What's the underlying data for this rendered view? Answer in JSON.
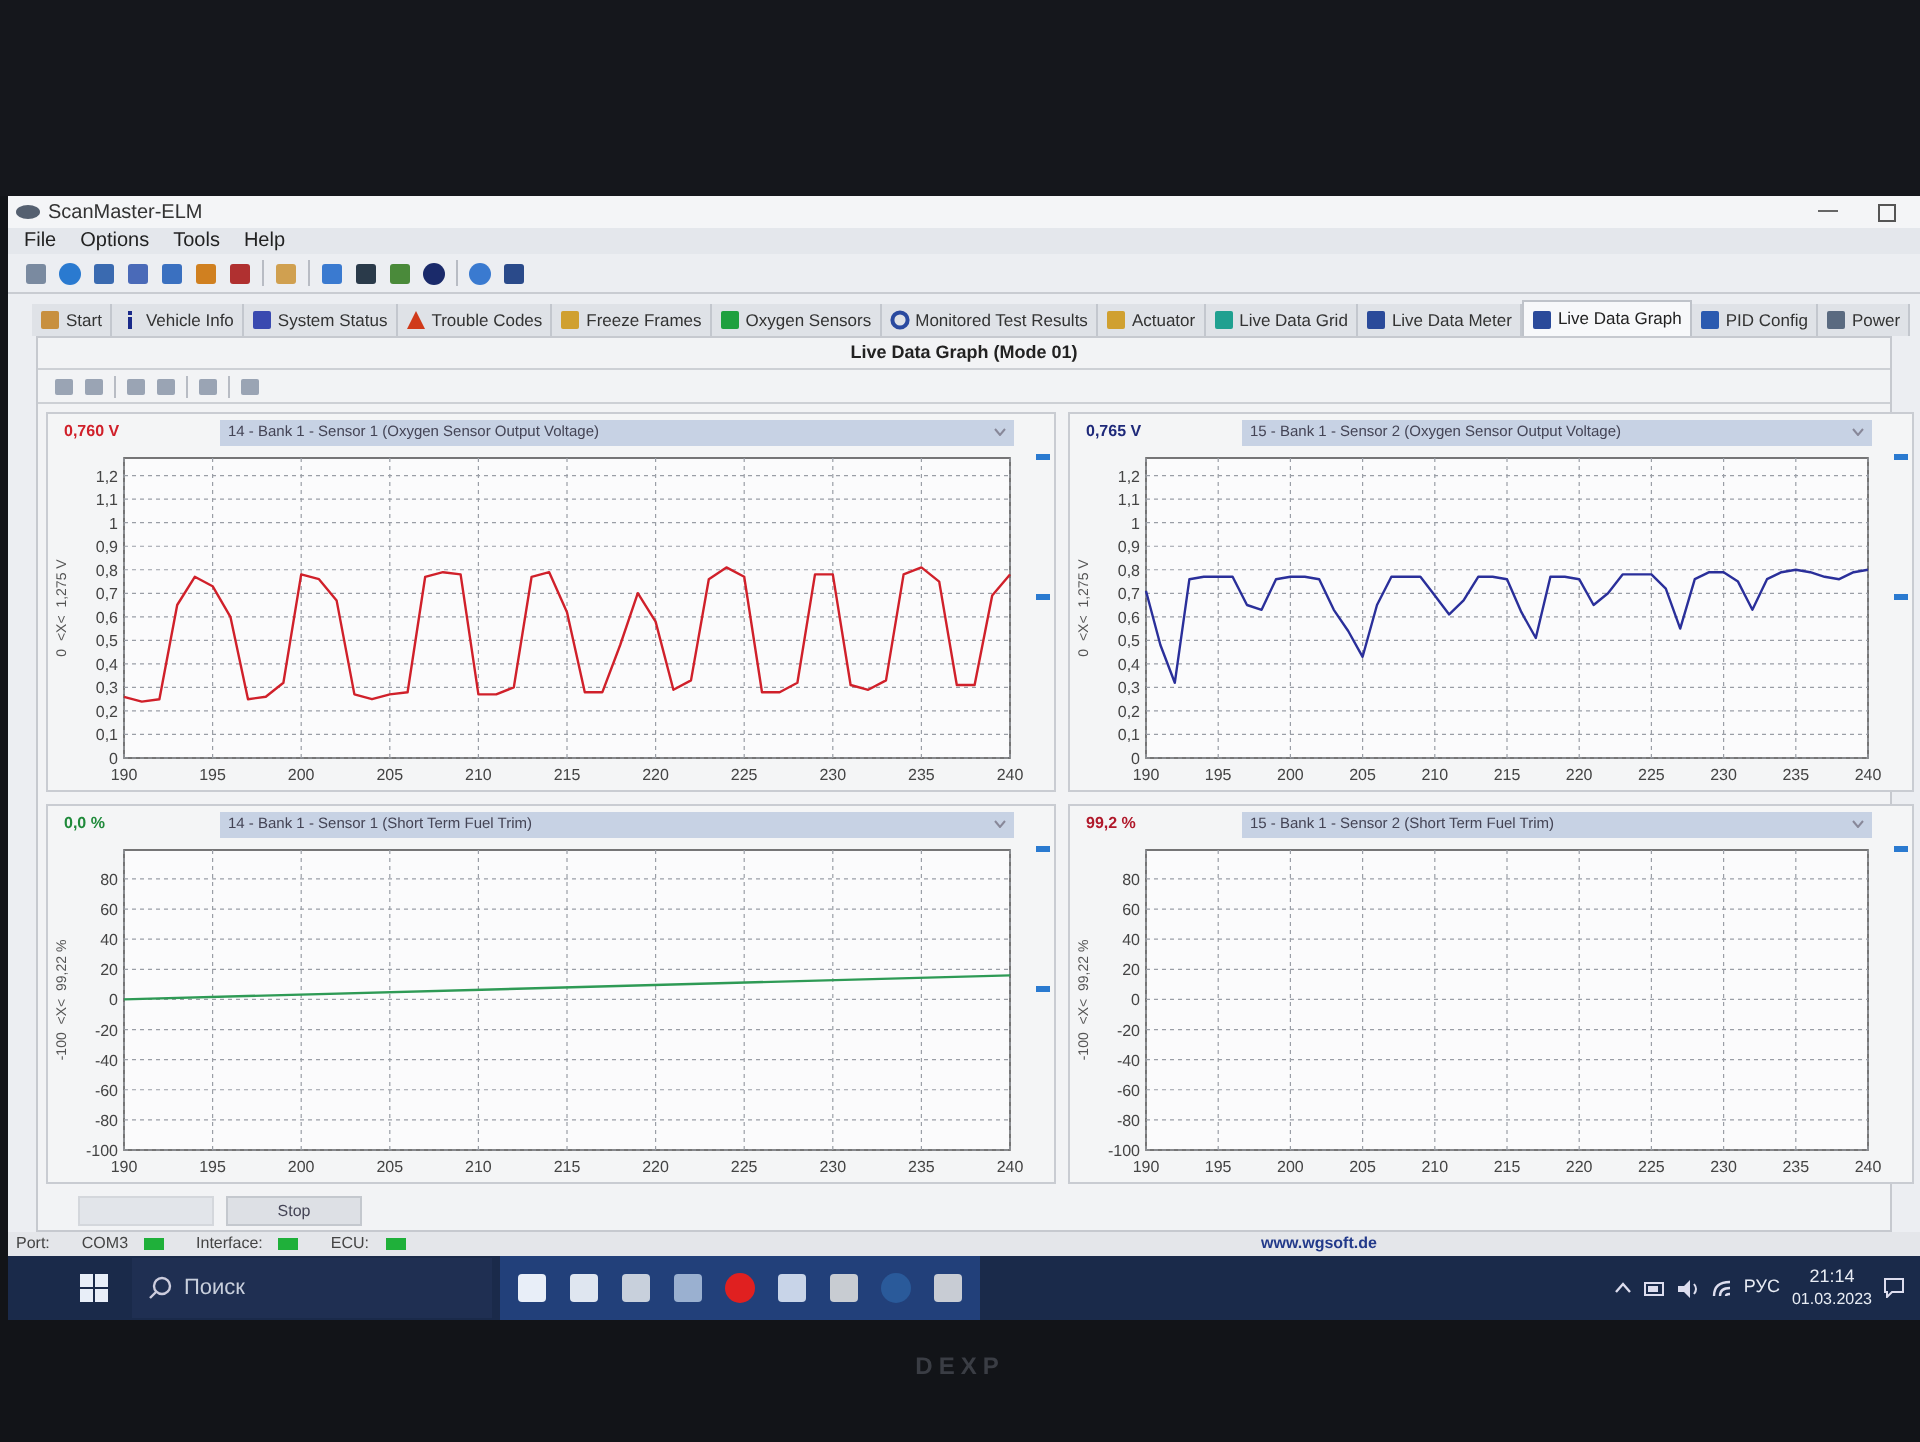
{
  "window": {
    "title": "ScanMaster-ELM"
  },
  "menu": [
    "File",
    "Options",
    "Tools",
    "Help"
  ],
  "tabs": [
    {
      "label": "Start",
      "selected": false
    },
    {
      "label": "Vehicle Info",
      "selected": false
    },
    {
      "label": "System Status",
      "selected": false
    },
    {
      "label": "Trouble Codes",
      "selected": false
    },
    {
      "label": "Freeze Frames",
      "selected": false
    },
    {
      "label": "Oxygen Sensors",
      "selected": false
    },
    {
      "label": "Monitored Test Results",
      "selected": false
    },
    {
      "label": "Actuator",
      "selected": false
    },
    {
      "label": "Live Data Grid",
      "selected": false
    },
    {
      "label": "Live Data Meter",
      "selected": false
    },
    {
      "label": "Live Data Graph",
      "selected": true
    },
    {
      "label": "PID Config",
      "selected": false
    },
    {
      "label": "Power",
      "selected": false
    }
  ],
  "page_title": "Live Data Graph (Mode 01)",
  "graphs": [
    {
      "reading": "0,760 V",
      "color": "#d0202a",
      "parameter": "14 - Bank 1 - Sensor 1 (Oxygen Sensor Output Voltage)",
      "chart_data": {
        "type": "line",
        "ylabel": "0  <X<  1,275 V",
        "xlim": [
          190,
          240
        ],
        "ylim": [
          0,
          1.275
        ],
        "xticks": [
          190,
          195,
          200,
          205,
          210,
          215,
          220,
          225,
          230,
          235,
          240
        ],
        "yticks": [
          {
            "value": 0,
            "label": "0"
          },
          {
            "value": 0.1,
            "label": "0,1"
          },
          {
            "value": 0.2,
            "label": "0,2"
          },
          {
            "value": 0.3,
            "label": "0,3"
          },
          {
            "value": 0.4,
            "label": "0,4"
          },
          {
            "value": 0.5,
            "label": "0,5"
          },
          {
            "value": 0.6,
            "label": "0,6"
          },
          {
            "value": 0.7,
            "label": "0,7"
          },
          {
            "value": 0.8,
            "label": "0,8"
          },
          {
            "value": 0.9,
            "label": "0,9"
          },
          {
            "value": 1,
            "label": "1"
          },
          {
            "value": 1.1,
            "label": "1,1"
          },
          {
            "value": 1.2,
            "label": "1,2"
          }
        ],
        "x": [
          190,
          191,
          192,
          193,
          194,
          195,
          196,
          197,
          198,
          199,
          200,
          201,
          202,
          203,
          204,
          205,
          206,
          207,
          208,
          209,
          210,
          211,
          212,
          213,
          214,
          215,
          216,
          217,
          218,
          219,
          220,
          221,
          222,
          223,
          224,
          225,
          226,
          227,
          228,
          229,
          230,
          231,
          232,
          233,
          234,
          235,
          236,
          237,
          238,
          239,
          240
        ],
        "grid": true,
        "series": [
          {
            "color": "#d0202a",
            "values": [
              0.26,
              0.24,
              0.25,
              0.65,
              0.77,
              0.73,
              0.6,
              0.25,
              0.26,
              0.32,
              0.78,
              0.76,
              0.67,
              0.27,
              0.25,
              0.27,
              0.28,
              0.77,
              0.79,
              0.78,
              0.27,
              0.27,
              0.3,
              0.77,
              0.79,
              0.62,
              0.28,
              0.28,
              0.48,
              0.7,
              0.58,
              0.29,
              0.33,
              0.76,
              0.81,
              0.77,
              0.28,
              0.28,
              0.32,
              0.78,
              0.78,
              0.31,
              0.29,
              0.33,
              0.78,
              0.81,
              0.75,
              0.31,
              0.31,
              0.69,
              0.78
            ]
          }
        ]
      }
    },
    {
      "reading": "0,765 V",
      "color": "#1f2a7a",
      "parameter": "15 - Bank 1 - Sensor 2 (Oxygen Sensor Output Voltage)",
      "chart_data": {
        "type": "line",
        "ylabel": "0  <X<  1,275 V",
        "xlim": [
          190,
          240
        ],
        "ylim": [
          0,
          1.275
        ],
        "xticks": [
          190,
          195,
          200,
          205,
          210,
          215,
          220,
          225,
          230,
          235,
          240
        ],
        "yticks": [
          {
            "value": 0,
            "label": "0"
          },
          {
            "value": 0.1,
            "label": "0,1"
          },
          {
            "value": 0.2,
            "label": "0,2"
          },
          {
            "value": 0.3,
            "label": "0,3"
          },
          {
            "value": 0.4,
            "label": "0,4"
          },
          {
            "value": 0.5,
            "label": "0,5"
          },
          {
            "value": 0.6,
            "label": "0,6"
          },
          {
            "value": 0.7,
            "label": "0,7"
          },
          {
            "value": 0.8,
            "label": "0,8"
          },
          {
            "value": 0.9,
            "label": "0,9"
          },
          {
            "value": 1,
            "label": "1"
          },
          {
            "value": 1.1,
            "label": "1,1"
          },
          {
            "value": 1.2,
            "label": "1,2"
          }
        ],
        "x": [
          190,
          191,
          192,
          193,
          194,
          195,
          196,
          197,
          198,
          199,
          200,
          201,
          202,
          203,
          204,
          205,
          206,
          207,
          208,
          209,
          210,
          211,
          212,
          213,
          214,
          215,
          216,
          217,
          218,
          219,
          220,
          221,
          222,
          223,
          224,
          225,
          226,
          227,
          228,
          229,
          230,
          231,
          232,
          233,
          234,
          235,
          236,
          237,
          238,
          239,
          240
        ],
        "grid": true,
        "series": [
          {
            "color": "#2a2f9a",
            "values": [
              0.71,
              0.48,
              0.32,
              0.76,
              0.77,
              0.77,
              0.77,
              0.65,
              0.63,
              0.76,
              0.77,
              0.77,
              0.76,
              0.63,
              0.54,
              0.43,
              0.65,
              0.77,
              0.77,
              0.77,
              0.69,
              0.61,
              0.67,
              0.77,
              0.77,
              0.76,
              0.62,
              0.51,
              0.77,
              0.77,
              0.76,
              0.65,
              0.7,
              0.78,
              0.78,
              0.78,
              0.72,
              0.55,
              0.76,
              0.79,
              0.79,
              0.75,
              0.63,
              0.76,
              0.79,
              0.8,
              0.79,
              0.77,
              0.76,
              0.79,
              0.8
            ]
          }
        ]
      }
    },
    {
      "reading": "0,0 %",
      "color": "#1f8a3a",
      "parameter": "14 - Bank 1 - Sensor 1 (Short Term Fuel Trim)",
      "chart_data": {
        "type": "line",
        "ylabel": "-100  <X<  99,22 %",
        "xlim": [
          190,
          240
        ],
        "ylim": [
          -100,
          99.22
        ],
        "xticks": [
          190,
          195,
          200,
          205,
          210,
          215,
          220,
          225,
          230,
          235,
          240
        ],
        "yticks": [
          -100,
          -80,
          -60,
          -40,
          -20,
          0,
          20,
          40,
          60,
          80
        ],
        "x": [
          190,
          240
        ],
        "grid": true,
        "series": [
          {
            "color": "#2e9a55",
            "values": [
              0,
              16
            ]
          }
        ]
      }
    },
    {
      "reading": "99,2 %",
      "color": "#b0182a",
      "parameter": "15 - Bank 1 - Sensor 2 (Short Term Fuel Trim)",
      "chart_data": {
        "type": "line",
        "ylabel": "-100  <X<  99,22 %",
        "xlim": [
          190,
          240
        ],
        "ylim": [
          -100,
          99.22
        ],
        "xticks": [
          190,
          195,
          200,
          205,
          210,
          215,
          220,
          225,
          230,
          235,
          240
        ],
        "yticks": [
          -100,
          -80,
          -60,
          -40,
          -20,
          0,
          20,
          40,
          60,
          80
        ],
        "grid": true
      }
    }
  ],
  "buttons": [
    {
      "disabled": true
    },
    {
      "label": "Stop",
      "disabled": false
    }
  ],
  "status_bar": {
    "port_label": "Port:",
    "indicators": [
      {
        "label": "COM3",
        "on": true
      },
      {
        "label": "Interface:",
        "on": true
      },
      {
        "label": "ECU:",
        "on": true
      }
    ],
    "website": "www.wgsoft.de"
  },
  "taskbar": {
    "search": {
      "placeholder": "Поиск"
    },
    "language": "РУС",
    "time": "21:14",
    "date": "01.03.2023"
  },
  "monitor_brand": "DEXP"
}
